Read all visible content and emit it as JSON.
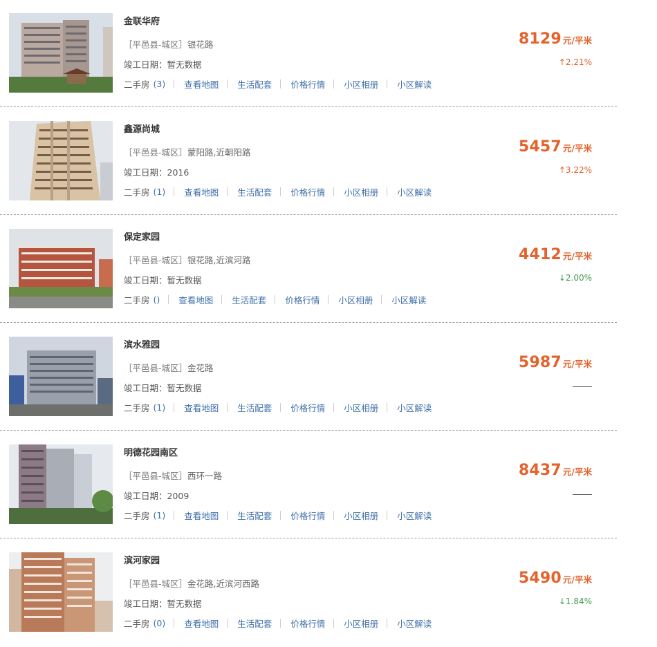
{
  "labels": {
    "built_prefix": "竣工日期：",
    "second_hand": "二手房",
    "price_unit": "元/平米"
  },
  "links": {
    "map": "查看地图",
    "life": "生活配套",
    "market": "价格行情",
    "album": "小区相册",
    "review": "小区解读"
  },
  "colors": {
    "price": "#e4622b",
    "up": "#e4622b",
    "down": "#3f9b4e",
    "link": "#3f6fa8"
  },
  "listings": [
    {
      "name": "金联华府",
      "district": "［平邑县-城区］",
      "road": "银花路",
      "built": "暂无数据",
      "count": "(3)",
      "price": "8129",
      "trend": "up",
      "change": "↑2.21%",
      "photo_icon": "building-photo"
    },
    {
      "name": "鑫源尚城",
      "district": "［平邑县-城区］",
      "road": "蒙阳路,近朝阳路",
      "built": "2016",
      "count": "(1)",
      "price": "5457",
      "trend": "up",
      "change": "↑3.22%",
      "photo_icon": "building-photo"
    },
    {
      "name": "保定家园",
      "district": "［平邑县-城区］",
      "road": "银花路,近滨河路",
      "built": "暂无数据",
      "count": "()",
      "price": "4412",
      "trend": "down",
      "change": "↓2.00%",
      "photo_icon": "building-photo"
    },
    {
      "name": "滨水雅园",
      "district": "［平邑县-城区］",
      "road": "金花路",
      "built": "暂无数据",
      "count": "(1)",
      "price": "5987",
      "trend": "flat",
      "change": "",
      "photo_icon": "building-photo"
    },
    {
      "name": "明德花园南区",
      "district": "［平邑县-城区］",
      "road": "西环一路",
      "built": "2009",
      "count": "(1)",
      "price": "8437",
      "trend": "flat",
      "change": "",
      "photo_icon": "building-photo"
    },
    {
      "name": "滨河家园",
      "district": "［平邑县-城区］",
      "road": "金花路,近滨河西路",
      "built": "暂无数据",
      "count": "(0)",
      "price": "5490",
      "trend": "down",
      "change": "↓1.84%",
      "photo_icon": "building-photo"
    }
  ]
}
